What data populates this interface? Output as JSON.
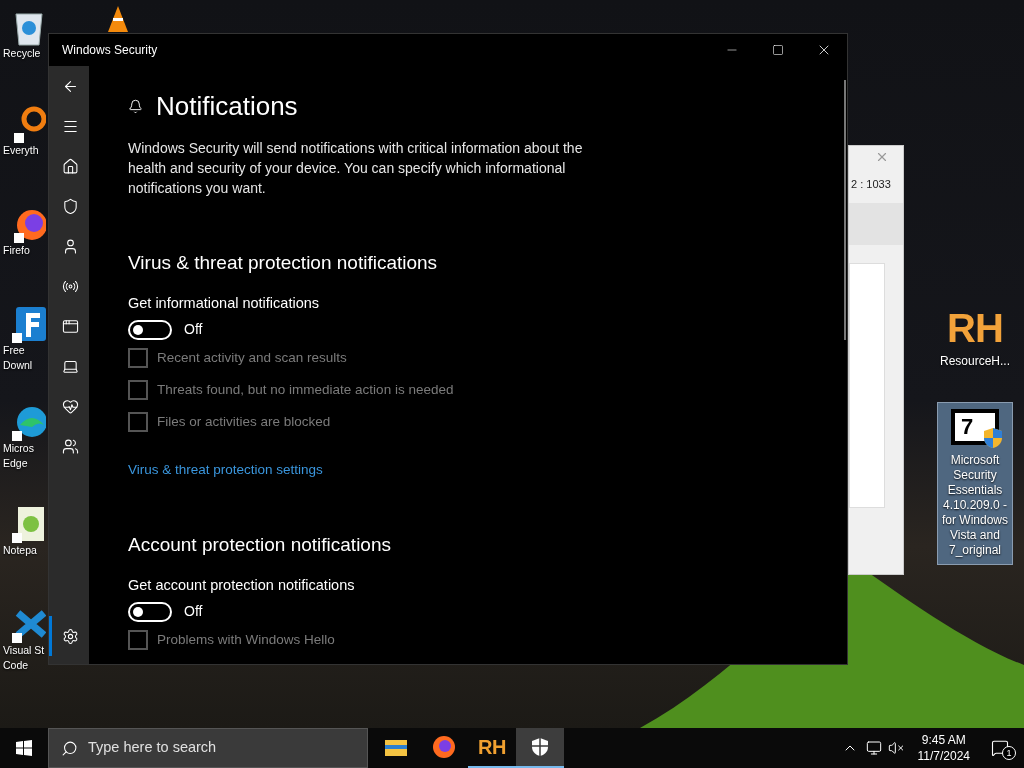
{
  "desktop_icons_left": [
    {
      "kind": "recycle",
      "lines": [
        "Recycle"
      ]
    },
    {
      "kind": "everything",
      "lines": [
        "Everyth"
      ]
    },
    {
      "kind": "firefox",
      "lines": [
        "Firefo"
      ]
    },
    {
      "kind": "download",
      "lines": [
        "Free",
        "Downl"
      ]
    },
    {
      "kind": "edge",
      "lines": [
        "Micros",
        "Edge"
      ]
    },
    {
      "kind": "notepad",
      "lines": [
        "Notepa"
      ]
    },
    {
      "kind": "vscode",
      "lines": [
        "Visual St",
        "Code"
      ]
    }
  ],
  "desktop_icons_right": [
    {
      "kind": "rh",
      "logo": "RH",
      "label": "ResourceH...",
      "selected": false
    },
    {
      "kind": "installer",
      "logo": "7",
      "label": "Microsoft Security Essentials 4.10.209.0 - for Windows Vista and 7_original",
      "selected": true
    }
  ],
  "background_window": {
    "text": "2 : 1033"
  },
  "window": {
    "title": "Windows Security"
  },
  "sidebar": {
    "items": [
      {
        "kind": "back",
        "selected": false
      },
      {
        "kind": "menu",
        "selected": false
      },
      {
        "kind": "home",
        "selected": false
      },
      {
        "kind": "shield",
        "selected": false
      },
      {
        "kind": "account",
        "selected": false
      },
      {
        "kind": "network",
        "selected": false
      },
      {
        "kind": "app",
        "selected": false
      },
      {
        "kind": "device",
        "selected": false
      },
      {
        "kind": "health",
        "selected": false
      },
      {
        "kind": "family",
        "selected": false
      },
      {
        "kind": "settings",
        "selected": true
      }
    ]
  },
  "page": {
    "title": "Notifications",
    "description": "Windows Security will send notifications with critical information about the health and security of your device. You can specify which informational notifications you want."
  },
  "sections": [
    {
      "title": "Virus & threat protection notifications",
      "toggle_label": "Get informational notifications",
      "toggle": {
        "on": false,
        "state_text": "Off"
      },
      "options": [
        {
          "label": "Recent activity and scan results",
          "checked": false,
          "disabled": true
        },
        {
          "label": "Threats found, but no immediate action is needed",
          "checked": false,
          "disabled": true
        },
        {
          "label": "Files or activities are blocked",
          "checked": false,
          "disabled": true
        }
      ],
      "link": "Virus & threat protection settings"
    },
    {
      "title": "Account protection notifications",
      "toggle_label": "Get account protection notifications",
      "toggle": {
        "on": false,
        "state_text": "Off"
      },
      "options": [
        {
          "label": "Problems with Windows Hello",
          "checked": false,
          "disabled": true
        }
      ]
    }
  ],
  "taskbar": {
    "search_placeholder": "Type here to search",
    "apps": [
      {
        "kind": "explorer",
        "running": false,
        "selected": false
      },
      {
        "kind": "firefox",
        "running": false,
        "selected": false
      },
      {
        "kind": "rh",
        "logo": "RH",
        "running": true,
        "selected": false
      },
      {
        "kind": "security",
        "running": true,
        "selected": true
      }
    ],
    "time": "9:45 AM",
    "date": "11/7/2024",
    "notification_count": "1"
  }
}
